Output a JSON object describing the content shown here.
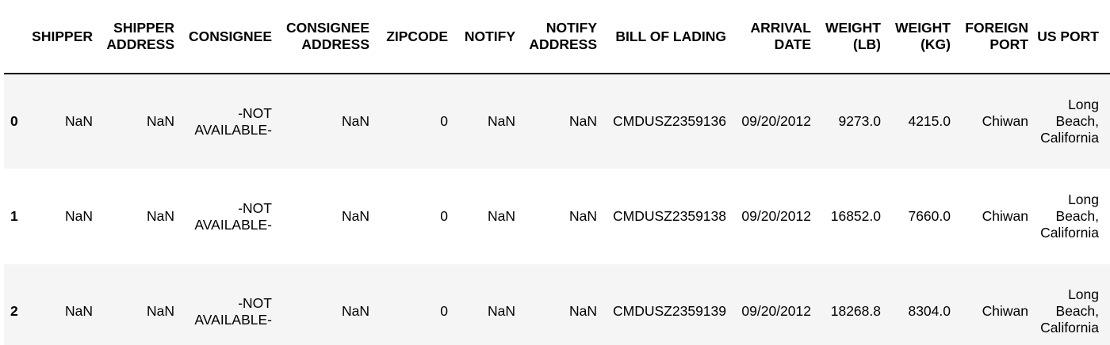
{
  "table": {
    "columns": [
      "",
      "SHIPPER",
      "SHIPPER ADDRESS",
      "CONSIGNEE",
      "CONSIGNEE ADDRESS",
      "ZIPCODE",
      "NOTIFY",
      "NOTIFY ADDRESS",
      "BILL OF LADING",
      "ARRIVAL DATE",
      "WEIGHT (LB)",
      "WEIGHT (KG)",
      "FOREIGN PORT",
      "US PORT",
      "("
    ],
    "rows": [
      {
        "index": "0",
        "cells": [
          "NaN",
          "NaN",
          "-NOT AVAILABLE-",
          "NaN",
          "0",
          "NaN",
          "NaN",
          "CMDUSZ2359136",
          "09/20/2012",
          "9273.0",
          "4215.0",
          "Chiwan",
          "Long Beach, California",
          ""
        ]
      },
      {
        "index": "1",
        "cells": [
          "NaN",
          "NaN",
          "-NOT AVAILABLE-",
          "NaN",
          "0",
          "NaN",
          "NaN",
          "CMDUSZ2359138",
          "09/20/2012",
          "16852.0",
          "7660.0",
          "Chiwan",
          "Long Beach, California",
          ""
        ]
      },
      {
        "index": "2",
        "cells": [
          "NaN",
          "NaN",
          "-NOT AVAILABLE-",
          "NaN",
          "0",
          "NaN",
          "NaN",
          "CMDUSZ2359139",
          "09/20/2012",
          "18268.8",
          "8304.0",
          "Chiwan",
          "Long Beach, California",
          ""
        ]
      }
    ]
  }
}
